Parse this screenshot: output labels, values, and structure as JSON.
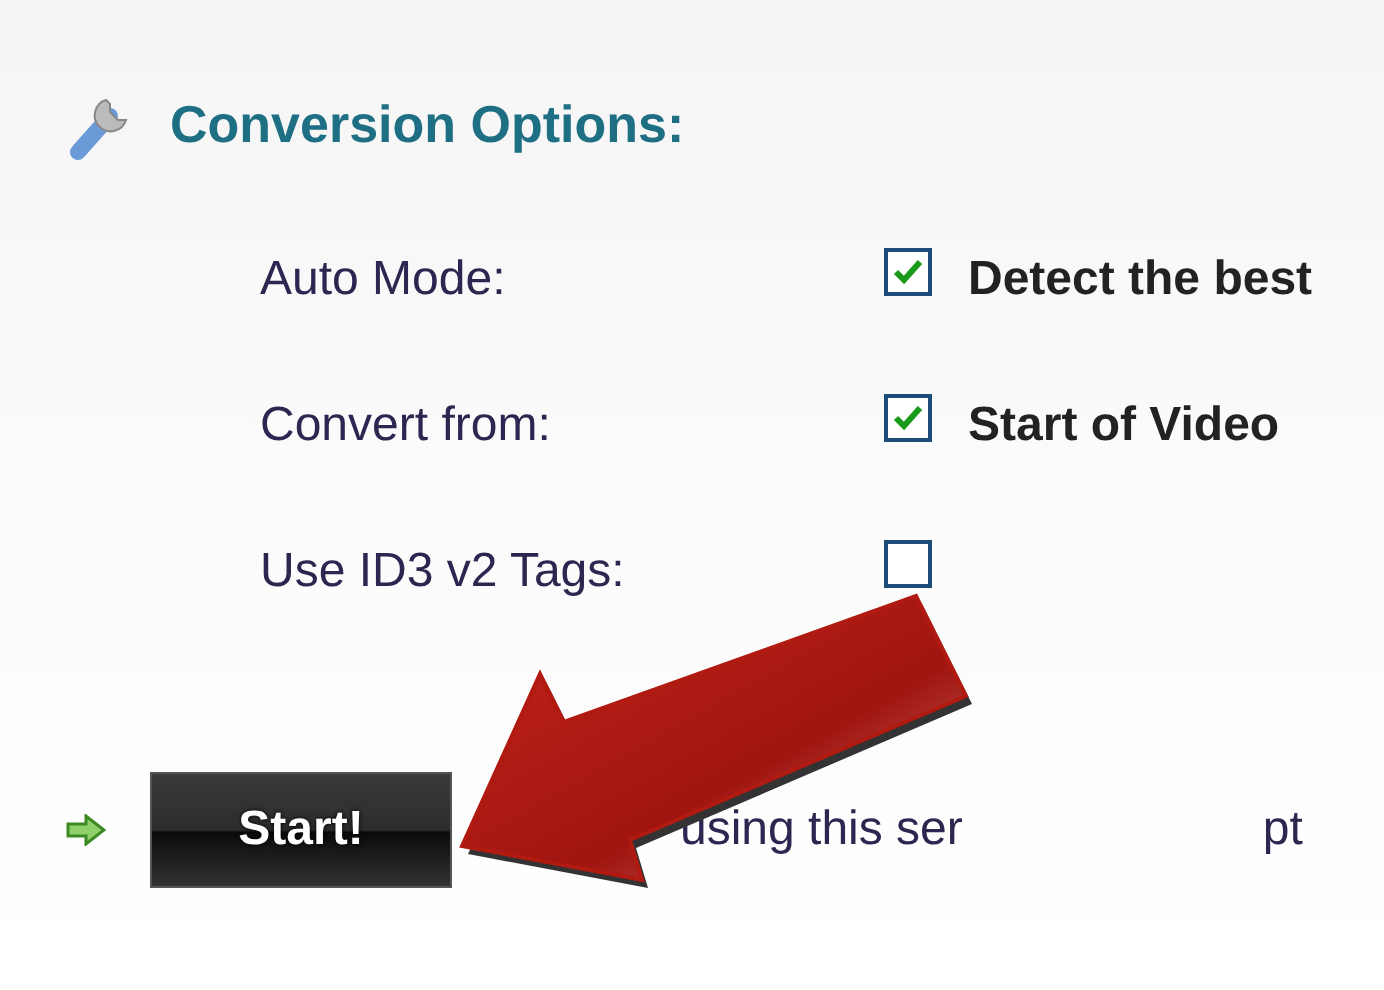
{
  "section": {
    "title": "Conversion Options:"
  },
  "options": [
    {
      "label": "Auto Mode:",
      "checked": true,
      "value": "Detect the best"
    },
    {
      "label": "Convert from:",
      "checked": true,
      "value": "Start of Video"
    },
    {
      "label": "Use ID3 v2 Tags:",
      "checked": false
    }
  ],
  "start_button": {
    "label": "Start!"
  },
  "footer_texts": [
    "using this ser",
    "pt"
  ]
}
